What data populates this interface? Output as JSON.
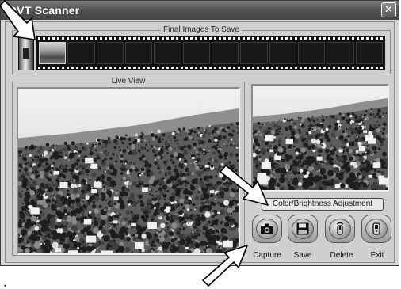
{
  "window": {
    "title": "DVT Scanner",
    "close_glyph": "✕"
  },
  "final_images": {
    "label": "Final Images To Save",
    "frame_count": 12,
    "filled_frames": 1
  },
  "live_view": {
    "label": "Live  View"
  },
  "preview": {
    "adjust_button_label": "Color/Brightness Adjustment"
  },
  "actions": [
    {
      "id": "capture",
      "label": "Capture",
      "icon": "camera-icon"
    },
    {
      "id": "save",
      "label": "Save",
      "icon": "floppy-disk-icon"
    },
    {
      "id": "delete",
      "label": "Delete",
      "icon": "trash-icon"
    },
    {
      "id": "exit",
      "label": "Exit",
      "icon": "exit-door-icon"
    }
  ],
  "colors": {
    "titlebar": "#555555",
    "window_bg": "#d6d6d6",
    "film": "#111111"
  }
}
